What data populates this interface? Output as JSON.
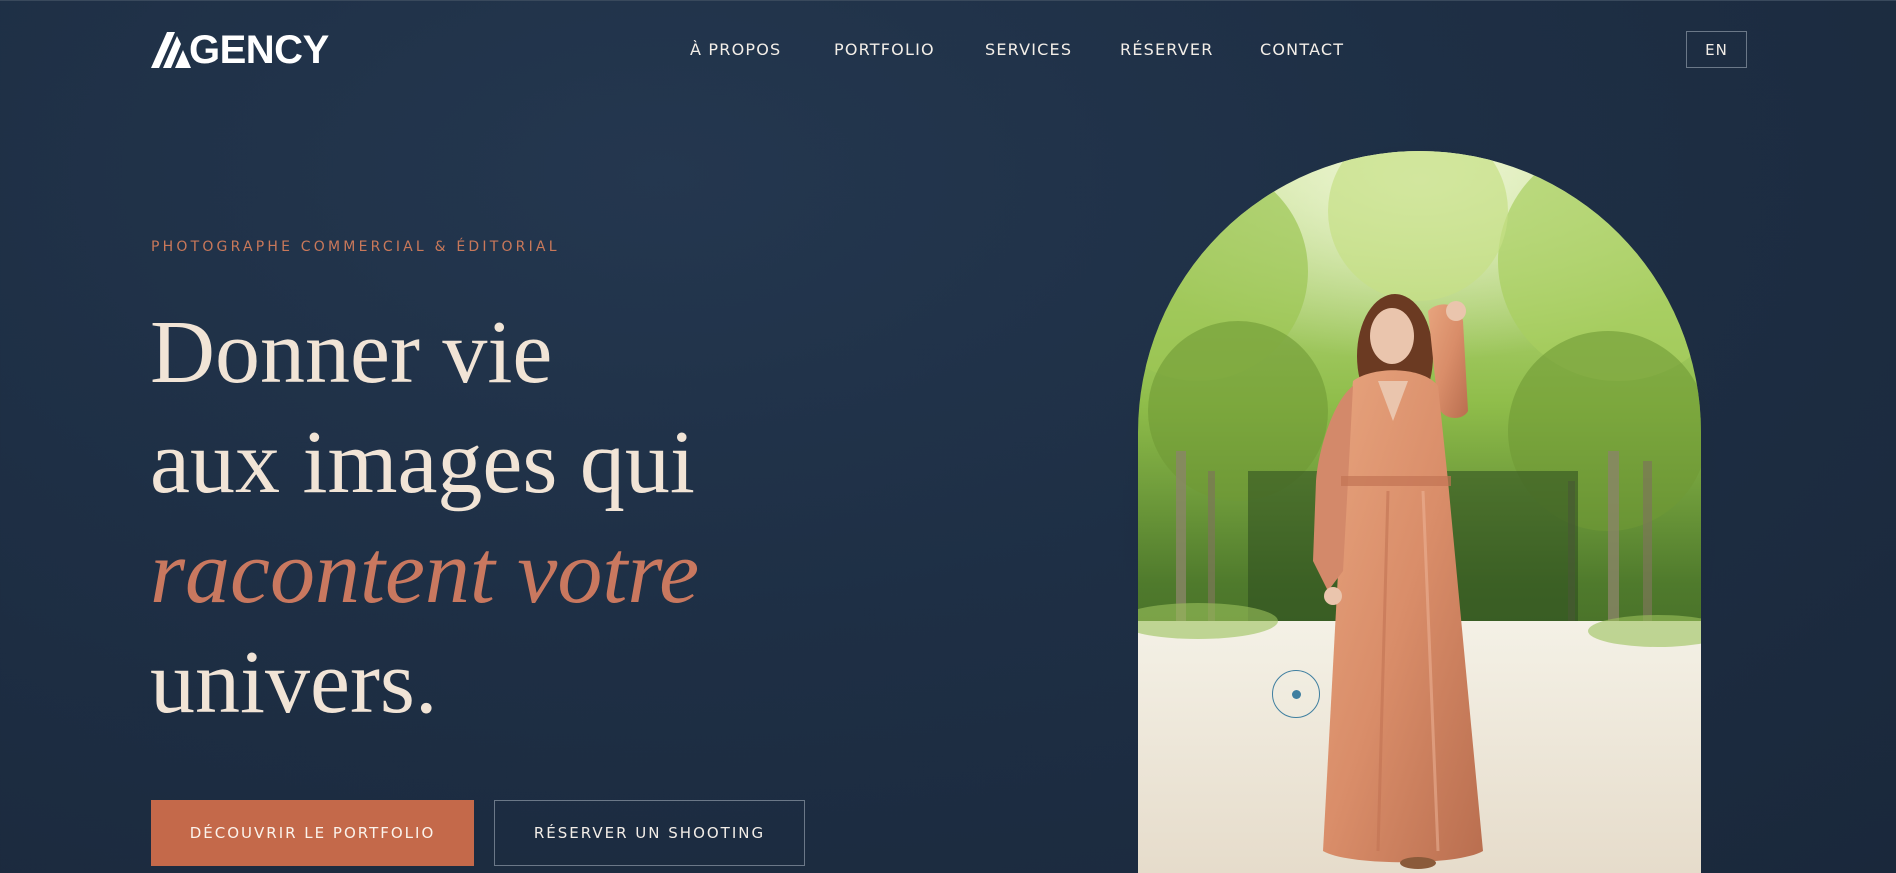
{
  "brand": {
    "logo_text": "GENCY"
  },
  "nav": {
    "items": [
      {
        "label": "À PROPOS"
      },
      {
        "label": "PORTFOLIO"
      },
      {
        "label": "SERVICES"
      },
      {
        "label": "RÉSERVER"
      },
      {
        "label": "CONTACT"
      }
    ],
    "language_label": "EN"
  },
  "hero": {
    "eyebrow": "PHOTOGRAPHE COMMERCIAL & ÉDITORIAL",
    "headline_lines": [
      "Donner vie",
      "aux images qui",
      "racontent votre",
      "univers."
    ],
    "primary_button": "DÉCOUVRIR LE PORTFOLIO",
    "secondary_button": "RÉSERVER UN SHOOTING"
  },
  "colors": {
    "background": "#1e2f45",
    "accent": "#c4694a",
    "headline": "#f1e4d6",
    "eyebrow": "#c9785a"
  },
  "icons": {
    "logo_mark": "stylized-a-logo-icon",
    "cursor_indicator": "circle-dot-icon"
  }
}
